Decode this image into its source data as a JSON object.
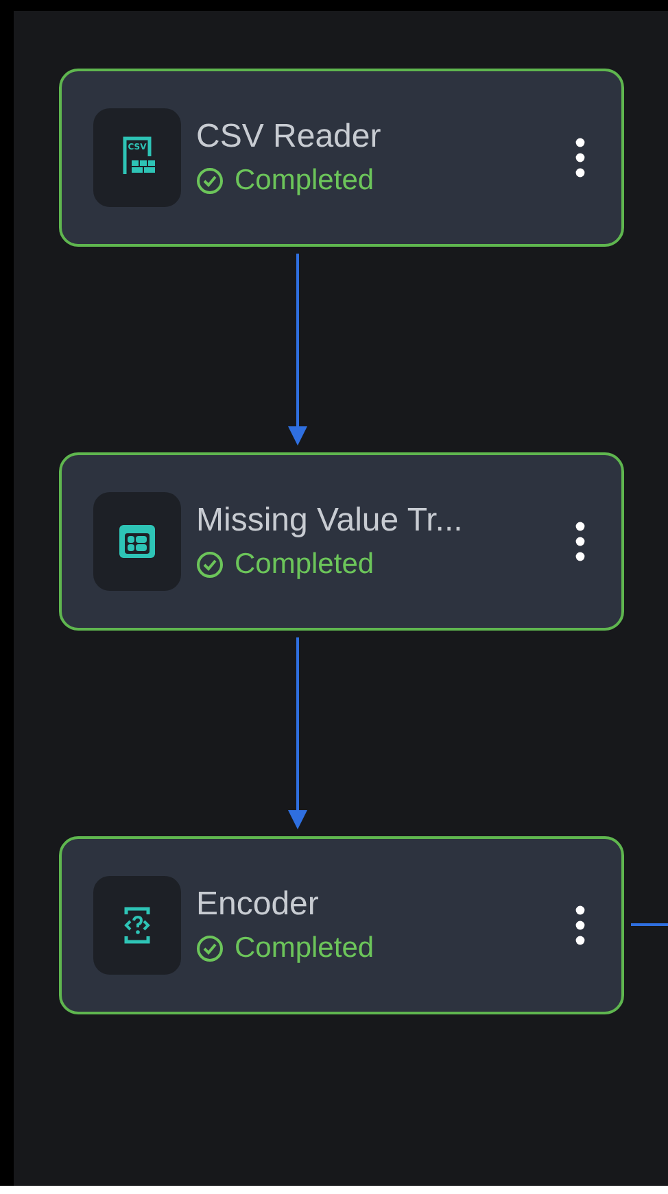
{
  "nodes": [
    {
      "title": "CSV Reader",
      "kind": "csv",
      "icon_label": "CSV",
      "status": {
        "kind": "completed",
        "text": "Completed"
      }
    },
    {
      "title": "Missing Value Tr...",
      "kind": "table",
      "status": {
        "kind": "completed",
        "text": "Completed"
      }
    },
    {
      "title": "Encoder",
      "kind": "code",
      "status": {
        "kind": "completed",
        "text": "Completed"
      }
    }
  ],
  "connectors": [
    {
      "kind": "arrow"
    },
    {
      "kind": "arrow"
    },
    {
      "kind": "line"
    }
  ]
}
